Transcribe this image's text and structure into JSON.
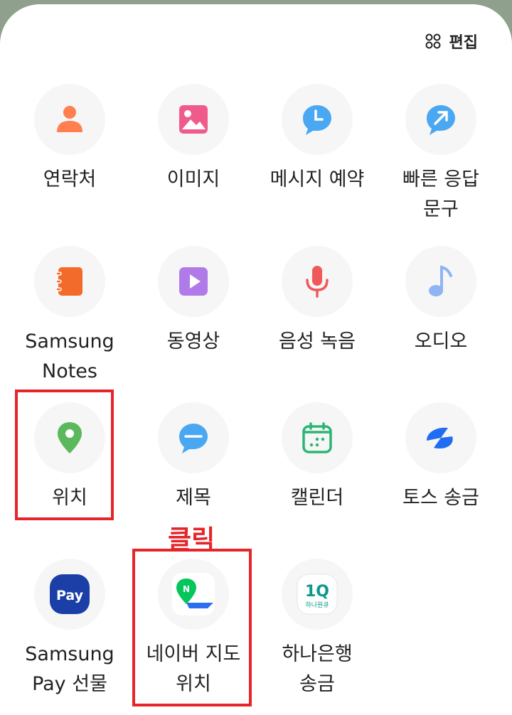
{
  "header": {
    "edit_label": "편집"
  },
  "items": [
    {
      "label": "연락처"
    },
    {
      "label": "이미지"
    },
    {
      "label": "메시지 예약"
    },
    {
      "label": "빠른 응답\n문구"
    },
    {
      "label": "Samsung\nNotes"
    },
    {
      "label": "동영상"
    },
    {
      "label": "음성 녹음"
    },
    {
      "label": "오디오"
    },
    {
      "label": "위치"
    },
    {
      "label": "제목"
    },
    {
      "label": "캘린더"
    },
    {
      "label": "토스 송금"
    },
    {
      "label": "Samsung\nPay 선물"
    },
    {
      "label": "네이버 지도\n위치"
    },
    {
      "label": "하나은행\n송금"
    }
  ],
  "annotation": {
    "text": "클릭"
  },
  "icons": {
    "pay_text": "Pay",
    "hana_logo_text": "1Q",
    "hana_sub_text": "하나원큐"
  },
  "colors": {
    "highlight": "#e5252a",
    "contact": "#ff7f4f",
    "image": "#ef5b8a",
    "message": "#4aa8f2",
    "notes": "#f26b2a",
    "video": "#b07ae8",
    "voice": "#f0595a",
    "audio": "#8fb4f4",
    "location": "#5cb85c",
    "calendar": "#2bb573",
    "toss": "#1f6df2",
    "samsung_pay": "#1b3fa7"
  }
}
